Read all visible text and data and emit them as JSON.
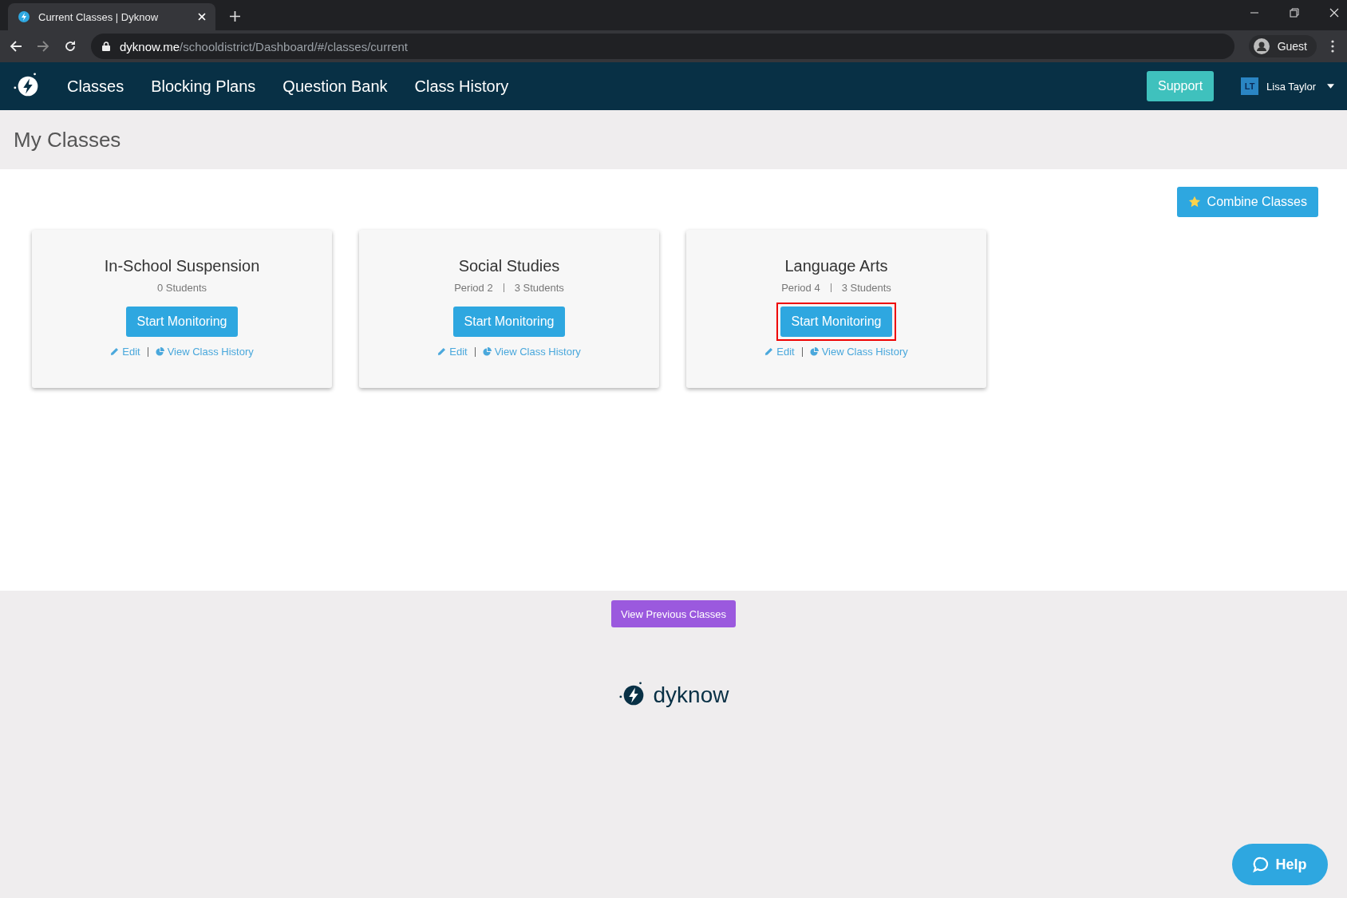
{
  "browser": {
    "tab_title": "Current Classes | Dyknow",
    "url_host": "dyknow.me",
    "url_path": "/schooldistrict/Dashboard/#/classes/current",
    "profile": "Guest"
  },
  "nav": {
    "items": [
      "Classes",
      "Blocking Plans",
      "Question Bank",
      "Class History"
    ],
    "support": "Support",
    "user_initials": "LT",
    "user_name": "Lisa Taylor"
  },
  "page_title": "My Classes",
  "combine_button": "Combine Classes",
  "classes": [
    {
      "name": "In-School Suspension",
      "students": "0 Students",
      "start": "Start Monitoring",
      "edit": "Edit",
      "history": "View Class History",
      "highlighted": false
    },
    {
      "name": "Social Studies",
      "period": "Period 2",
      "students": "3 Students",
      "start": "Start Monitoring",
      "edit": "Edit",
      "history": "View Class History",
      "highlighted": false
    },
    {
      "name": "Language Arts",
      "period": "Period 4",
      "students": "3 Students",
      "start": "Start Monitoring",
      "edit": "Edit",
      "history": "View Class History",
      "highlighted": true
    }
  ],
  "previous_button": "View Previous Classes",
  "footer_brand": "dyknow",
  "help_button": "Help"
}
